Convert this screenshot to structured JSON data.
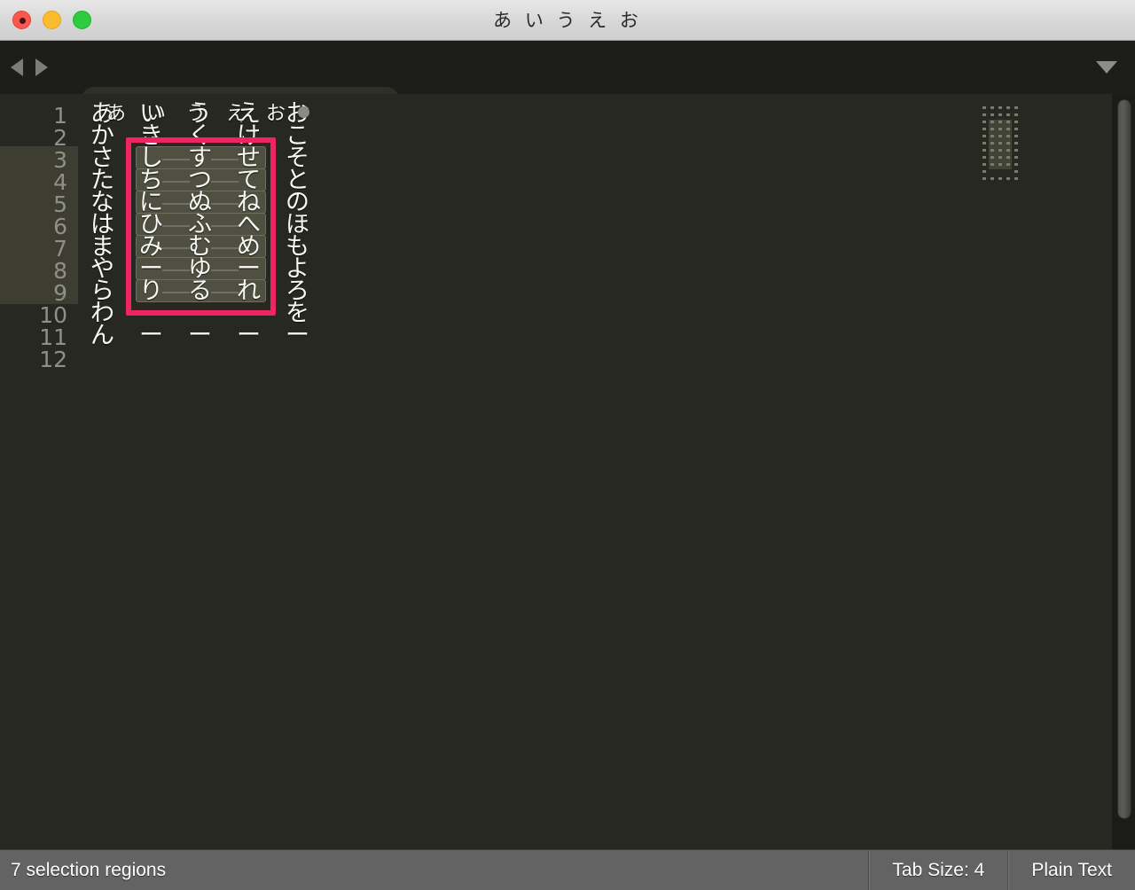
{
  "window": {
    "title": "あ い う え お",
    "controls": [
      {
        "name": "close",
        "color": "#f9584f"
      },
      {
        "name": "minimize",
        "color": "#fcbb2e"
      },
      {
        "name": "maximize",
        "color": "#2fcb3f"
      }
    ]
  },
  "tabbar": {
    "nav_back": "◀",
    "nav_forward": "▶",
    "menu": "▼",
    "tabs": [
      {
        "label": "あ い う え お",
        "dirty": true,
        "active": true
      }
    ]
  },
  "editor": {
    "line_count": 12,
    "line_numbers": [
      "1",
      "2",
      "3",
      "4",
      "5",
      "6",
      "7",
      "8",
      "9",
      "10",
      "11",
      "12"
    ],
    "highlighted_lines": [
      3,
      4,
      5,
      6,
      7,
      8,
      9
    ],
    "columns": 5,
    "lines": [
      {
        "n": 1,
        "cells": [
          "あ",
          "い",
          "う",
          "え",
          "お"
        ],
        "selected": false
      },
      {
        "n": 2,
        "cells": [
          "か",
          "き",
          "く",
          "け",
          "こ"
        ],
        "selected": false
      },
      {
        "n": 3,
        "cells": [
          "さ",
          "し",
          "す",
          "せ",
          "そ"
        ],
        "selected": true
      },
      {
        "n": 4,
        "cells": [
          "た",
          "ち",
          "つ",
          "て",
          "と"
        ],
        "selected": true
      },
      {
        "n": 5,
        "cells": [
          "な",
          "に",
          "ぬ",
          "ね",
          "の"
        ],
        "selected": true
      },
      {
        "n": 6,
        "cells": [
          "は",
          "ひ",
          "ふ",
          "へ",
          "ほ"
        ],
        "selected": true
      },
      {
        "n": 7,
        "cells": [
          "ま",
          "み",
          "む",
          "め",
          "も"
        ],
        "selected": true
      },
      {
        "n": 8,
        "cells": [
          "や",
          "ー",
          "ゆ",
          "ー",
          "よ"
        ],
        "selected": true
      },
      {
        "n": 9,
        "cells": [
          "ら",
          "り",
          "る",
          "れ",
          "ろ"
        ],
        "selected": true
      },
      {
        "n": 10,
        "cells": [
          "わ",
          "",
          "",
          "",
          "を"
        ],
        "selected": false
      },
      {
        "n": 11,
        "cells": [
          "ん",
          "ー",
          "ー",
          "ー",
          "ー"
        ],
        "selected": false
      },
      {
        "n": 12,
        "cells": [
          "",
          "",
          "",
          "",
          ""
        ],
        "selected": false
      }
    ],
    "selection_columns": [
      2,
      3,
      4
    ],
    "selection_first_line": 3,
    "selection_last_line": 9
  },
  "annotation": {
    "color": "#f0255f",
    "label": "selection-highlight-box"
  },
  "statusbar": {
    "selection_text": "7 selection regions",
    "tab_size": "Tab Size: 4",
    "syntax": "Plain Text"
  },
  "colors": {
    "editor_background": "#272822",
    "gutter_highlight": "#3e3d32",
    "selection_fill": "#4f4f42",
    "selection_border": "#6e6e5c",
    "text": "#f8f8f2",
    "line_number": "#8f908a",
    "tabbar_background": "#1d1e19",
    "tab_active": "#2e2f29",
    "statusbar_background": "#636363",
    "annotation": "#f0255f"
  }
}
